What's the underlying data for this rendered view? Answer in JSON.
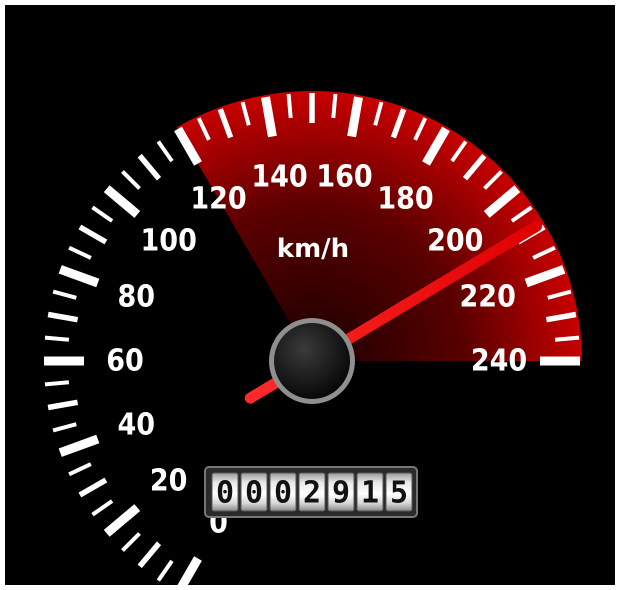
{
  "gauge": {
    "unit": "km/h",
    "scale_min": 0,
    "scale_max": 240,
    "major_step": 20,
    "minor_step": 5,
    "labels": [
      "0",
      "20",
      "40",
      "60",
      "80",
      "100",
      "120",
      "140",
      "160",
      "180",
      "200",
      "220",
      "240"
    ],
    "needle_value": 209,
    "redline_start": 120,
    "odometer": "0002915",
    "colors": {
      "background": "#000000",
      "ticks": "#ffffff",
      "needle": "#ff0000",
      "redline": "#c00000",
      "hub": "#111111",
      "hub_ring": "#9a9a9a"
    }
  }
}
